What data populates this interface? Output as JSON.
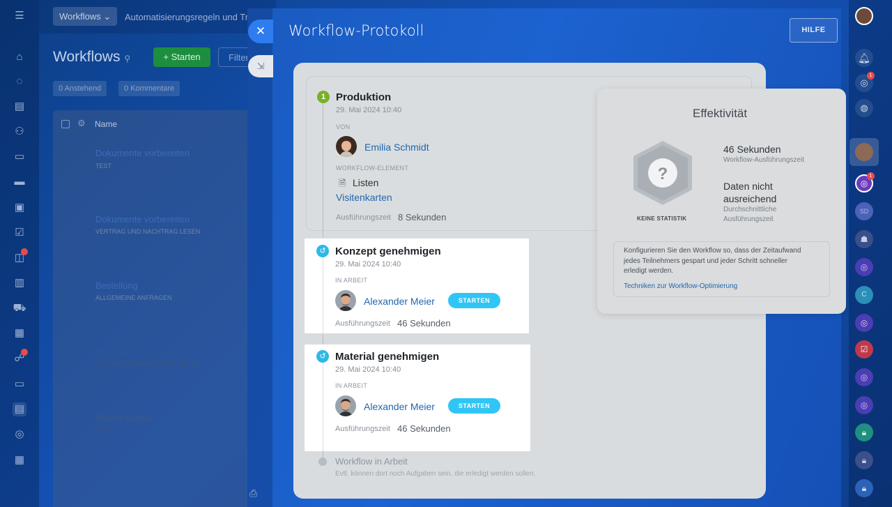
{
  "background": {
    "breadcrumb_workflows": "Workflows",
    "breadcrumb_automation": "Automatisierungsregeln und Trigger",
    "title": "Workflows",
    "start_button": "Starten",
    "filter": "Filter",
    "counters": [
      {
        "count": "0",
        "label": "Anstehend"
      },
      {
        "count": "0",
        "label": "Kommentare"
      }
    ],
    "list_header": "Name",
    "rows": [
      {
        "name": "Dokumente vorbereiten",
        "sub": "TEST"
      },
      {
        "name": "Dokumente vorbereiten",
        "sub": "VERTRAG UND NACHTRAG LESEN"
      },
      {
        "name": "Bestellung",
        "sub": "ALLGEMEINE ANFRAGEN"
      },
      {
        "name": "Dokument durchlesen",
        "sub": "AUTOMATISIERUNGSVORLAGE (1)"
      },
      {
        "name": "Muster GmbH",
        "sub": "TEST"
      }
    ]
  },
  "slider": {
    "title": "Workflow-Protokoll",
    "help_button": "HILFE",
    "close_icon": "close-icon",
    "steps": [
      {
        "number": "1",
        "title": "Produktion",
        "date": "29. Mai 2024 10:40",
        "from_label": "VON",
        "user": "Emilia Schmidt",
        "element_label": "WORKFLOW-ELEMENT",
        "element_type": "Listen",
        "element_link": "Visitenkarten",
        "duration_label": "Ausführungszeit",
        "duration": "8 Sekunden"
      },
      {
        "title": "Konzept genehmigen",
        "date": "29. Mai 2024 10:40",
        "status_label": "IN ARBEIT",
        "user": "Alexander Meier",
        "action": "STARTEN",
        "duration_label": "Ausführungszeit",
        "duration": "46 Sekunden"
      },
      {
        "title": "Material genehmigen",
        "date": "29. Mai 2024 10:40",
        "status_label": "IN ARBEIT",
        "user": "Alexander Meier",
        "action": "STARTEN",
        "duration_label": "Ausführungszeit",
        "duration": "46 Sekunden"
      }
    ],
    "final_step": {
      "title": "Workflow in Arbeit",
      "description": "Evtl. können dort noch Aufgaben sein, die erledigt werden sollen."
    }
  },
  "effectiveness": {
    "title": "Effektivität",
    "badge_label": "KEINE STATISTIK",
    "execution_time_value": "46 Sekunden",
    "execution_time_label": "Workflow-Ausführungszeit",
    "average_value": "Daten nicht ausreichend",
    "average_label": "Durchschnittliche Ausführungszeit",
    "tip": "Konfigurieren Sie den Workflow so, dass der Zeitaufwand jedes Teilnehmers gespart und jeder Schritt schneller erledigt werden.",
    "tip_link": "Techniken zur Workflow-Optimierung"
  },
  "rightbar": {
    "badges": [
      "1",
      "1"
    ],
    "initials": [
      "SD",
      "C"
    ]
  },
  "colors": {
    "accent": "#2fc6f6",
    "link": "#2067b0",
    "step_done": "#7ab028",
    "background_blue": "#1553b8"
  }
}
